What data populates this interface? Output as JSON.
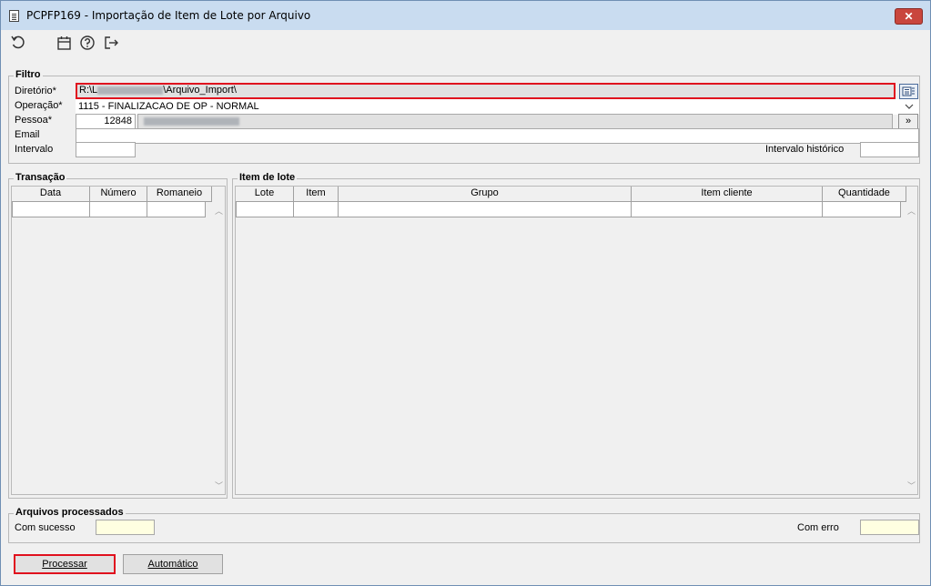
{
  "window": {
    "title": "PCPFP169 - Importação de Item de Lote por Arquivo",
    "close_label": "✕"
  },
  "toolbar": {
    "icons": [
      "refresh-icon",
      "calendar-icon",
      "help-icon",
      "exit-icon"
    ]
  },
  "filtro": {
    "label": "Filtro",
    "diretorio_label": "Diretório*",
    "diretorio_prefix": "R:\\L",
    "diretorio_suffix": "\\Arquivo_Import\\",
    "operacao_label": "Operação*",
    "operacao_value": "1115 - FINALIZACAO DE OP - NORMAL",
    "pessoa_label": "Pessoa*",
    "pessoa_code": "12848",
    "pessoa_btn": "»",
    "email_label": "Email",
    "email_value": "",
    "intervalo_label": "Intervalo",
    "intervalo_value": "",
    "intervalo_hist_label": "Intervalo histórico",
    "intervalo_hist_value": ""
  },
  "transacao": {
    "label": "Transação",
    "columns": [
      "Data",
      "Número",
      "Romaneio"
    ]
  },
  "item_lote": {
    "label": "Item de lote",
    "columns": [
      "Lote",
      "Item",
      "Grupo",
      "Item cliente",
      "Quantidade"
    ]
  },
  "arquivos": {
    "label": "Arquivos processados",
    "sucesso_label": "Com sucesso",
    "sucesso_value": "",
    "erro_label": "Com erro",
    "erro_value": ""
  },
  "buttons": {
    "processar": "Processar",
    "automatico": "Automático"
  }
}
